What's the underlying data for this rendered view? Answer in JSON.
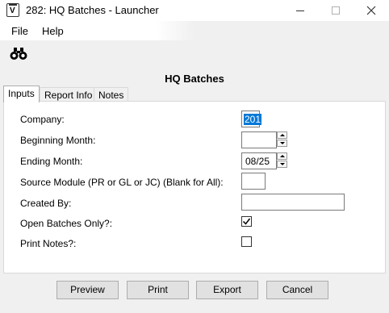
{
  "window": {
    "title": "282: HQ Batches - Launcher",
    "app_icon_letter": "V"
  },
  "menu": {
    "file": "File",
    "help": "Help"
  },
  "toolbar": {
    "find_icon": "binoculars-icon"
  },
  "panel": {
    "title": "HQ Batches"
  },
  "tabs": [
    {
      "label": "Inputs",
      "active": true
    },
    {
      "label": "Report Info",
      "active": false
    },
    {
      "label": "Notes",
      "active": false
    }
  ],
  "form": {
    "company": {
      "label": "Company:",
      "value": "201"
    },
    "beginning_month": {
      "label": "Beginning Month:",
      "value": ""
    },
    "ending_month": {
      "label": "Ending Month:",
      "value": "08/25"
    },
    "source_module": {
      "label": "Source Module (PR or GL or JC) (Blank for All):",
      "value": ""
    },
    "created_by": {
      "label": "Created By:",
      "value": ""
    },
    "open_batches_only": {
      "label": "Open Batches Only?:",
      "checked": true
    },
    "print_notes": {
      "label": "Print Notes?:",
      "checked": false
    }
  },
  "buttons": {
    "preview": "Preview",
    "print": "Print",
    "export": "Export",
    "cancel": "Cancel"
  }
}
